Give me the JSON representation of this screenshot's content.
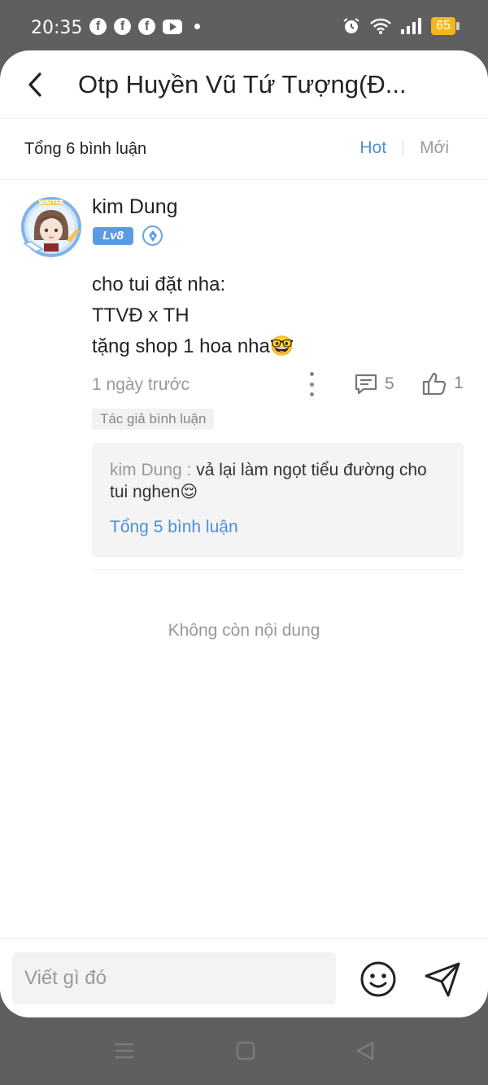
{
  "status_bar": {
    "time": "20:35",
    "app_icons": [
      "facebook-icon",
      "facebook-icon",
      "facebook-icon",
      "youtube-icon"
    ],
    "battery": "65",
    "colors": {
      "battery": "#f3b814"
    }
  },
  "header": {
    "title": "Otp Huyền Vũ Tứ Tượng(Đ..."
  },
  "comments_header": {
    "total": "Tổng 6 bình luận",
    "sort_hot": "Hot",
    "sort_new": "Mới"
  },
  "comment": {
    "username": "kim Dung",
    "level": "Lv8",
    "avatar_badge": "WRITER",
    "body_lines": [
      "cho tui đặt nha:",
      "TTVĐ x TH",
      "tặng shop 1 hoa nha🤓"
    ],
    "time": "1 ngày trước",
    "reply_count": "5",
    "like_count": "1",
    "tag": "Tác giả bình luận",
    "reply": {
      "name": "kim Dung : ",
      "text": "vả lại làm ngọt tiểu đường cho tui nghen😌"
    },
    "all_replies": "Tổng 5 bình luận"
  },
  "end_text": "Không còn nội dung",
  "input_bar": {
    "placeholder": "Viết gì đó"
  },
  "colors": {
    "accent": "#4a90d9",
    "level_badge": "#5b9be6"
  }
}
